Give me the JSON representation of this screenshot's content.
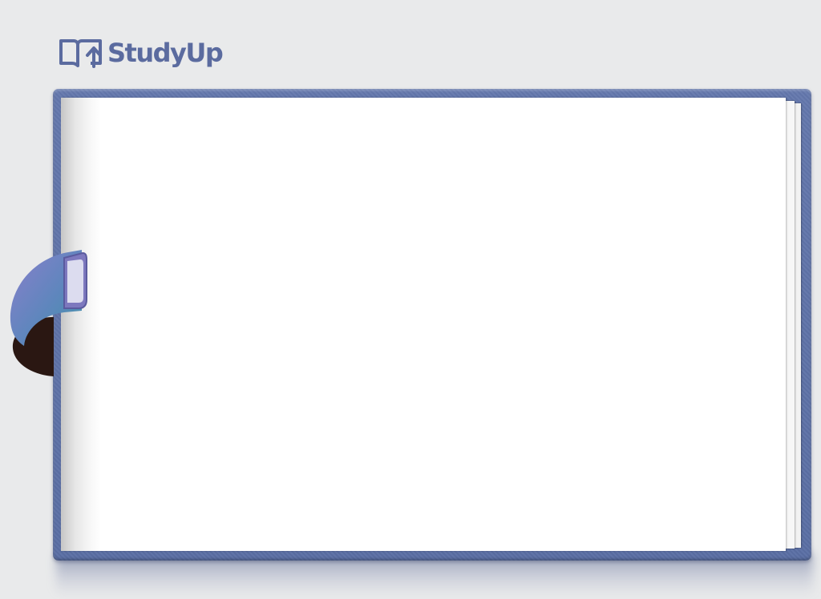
{
  "app": {
    "brand_name": "StudyUp",
    "logo_icon": "open-book-up-arrow-icon",
    "bookmark_icon": "bookmark-tab-icon"
  },
  "colors": {
    "background": "#e9eaeb",
    "brand": "#5b6b9f",
    "cover": "#6478ad",
    "page": "#ffffff",
    "tab_front": "#8a86c6",
    "tab_back": "#4d8fb0",
    "tab_inner": "#2a1712"
  }
}
